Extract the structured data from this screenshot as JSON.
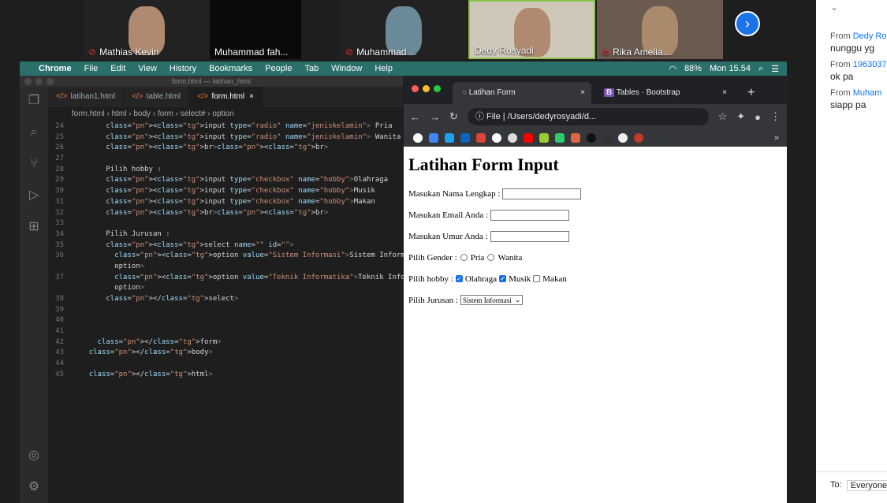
{
  "participants": [
    {
      "name": "Mathias Kevin",
      "muted": true
    },
    {
      "name": "Muhammad fah...",
      "muted": false
    },
    {
      "name": "Muhammad ...",
      "muted": true
    },
    {
      "name": "Dedy Rosyadi",
      "muted": false
    },
    {
      "name": "Rika Amelia ...",
      "muted": true
    }
  ],
  "menubar": {
    "items": [
      "Chrome",
      "File",
      "Edit",
      "View",
      "History",
      "Bookmarks",
      "People",
      "Tab",
      "Window",
      "Help"
    ],
    "battery": "88%",
    "clock": "Mon 15.54"
  },
  "vscode": {
    "title": "form.html — latihan_html",
    "tabs": [
      {
        "label": "latihan1.html"
      },
      {
        "label": "table.html"
      },
      {
        "label": "form.html"
      }
    ],
    "breadcrumbs": [
      "form.html",
      "html",
      "body",
      "form",
      "select#",
      "option"
    ],
    "lines": [
      {
        "n": "24",
        "t": "        <input type=\"radio\" name=\"jeniskelamin\"> Pria"
      },
      {
        "n": "25",
        "t": "        <input type=\"radio\" name=\"jeniskelamin\"> Wanita"
      },
      {
        "n": "26",
        "t": "        <br><br>"
      },
      {
        "n": "27",
        "t": ""
      },
      {
        "n": "28",
        "t": "        Pilih hobby :"
      },
      {
        "n": "29",
        "t": "        <input type=\"checkbox\" name=\"hobby\">Olahraga"
      },
      {
        "n": "30",
        "t": "        <input type=\"checkbox\" name=\"hobby\">Musik"
      },
      {
        "n": "31",
        "t": "        <input type=\"checkbox\" name=\"hobby\">Makan"
      },
      {
        "n": "32",
        "t": "        <br><br>"
      },
      {
        "n": "33",
        "t": ""
      },
      {
        "n": "34",
        "t": "        Pilih Jurusan :"
      },
      {
        "n": "35",
        "t": "        <select name=\"\" id=\"\">"
      },
      {
        "n": "36",
        "t": "          <option value=\"Sistem Informasi\">Sistem Informasi</"
      },
      {
        "n": "",
        "t": "          option>"
      },
      {
        "n": "37",
        "t": "          <option value=\"Teknik Informatika\">Teknik Informatika</"
      },
      {
        "n": "",
        "t": "          option>"
      },
      {
        "n": "38",
        "t": "        </select>"
      },
      {
        "n": "39",
        "t": ""
      },
      {
        "n": "40",
        "t": ""
      },
      {
        "n": "41",
        "t": ""
      },
      {
        "n": "42",
        "t": "      </form>"
      },
      {
        "n": "43",
        "t": "    </body>"
      },
      {
        "n": "44",
        "t": ""
      },
      {
        "n": "45",
        "t": "    </html>"
      }
    ]
  },
  "chrome": {
    "tabs": [
      {
        "label": "Latihan Form"
      },
      {
        "label": "Tables · Bootstrap"
      }
    ],
    "address": "/Users/dedyrosyadi/d...",
    "address_prefix": "File"
  },
  "page": {
    "title": "Latihan Form Input",
    "name_label": "Masukan Nama Lengkap :",
    "email_label": "Masukan Email Anda :",
    "age_label": "Masukan Umur Anda :",
    "gender_label": "Pilih Gender :",
    "gender_options": [
      "Pria",
      "Wanita"
    ],
    "hobby_label": "Pilih hobby :",
    "hobbies": [
      {
        "label": "Olahraga",
        "checked": true
      },
      {
        "label": "Musik",
        "checked": true
      },
      {
        "label": "Makan",
        "checked": false
      }
    ],
    "major_label": "Pilih Jurusan :",
    "major_selected": "Sistem Informasi"
  },
  "chat": {
    "messages": [
      {
        "from": "Dedy Ro",
        "text": "nunggu yg"
      },
      {
        "from": "1963037",
        "text": "ok pa"
      },
      {
        "from": "Muham",
        "text": "siapp pa"
      }
    ],
    "to_label": "To:",
    "to_value": "Everyone"
  }
}
